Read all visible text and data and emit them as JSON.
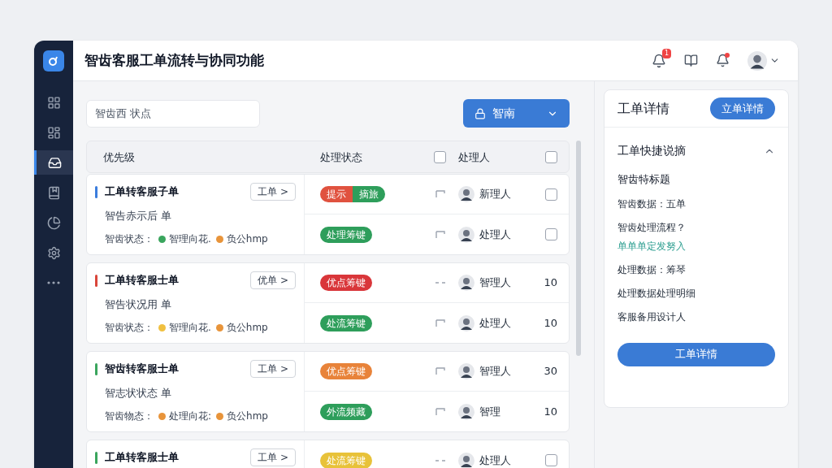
{
  "app": {
    "title": "智齿客服工单流转与协同功能"
  },
  "sidebar": {
    "items": [
      {
        "selected": false
      },
      {
        "selected": false
      },
      {
        "selected": true
      },
      {
        "selected": false
      },
      {
        "selected": false
      },
      {
        "selected": false
      },
      {
        "selected": false
      }
    ]
  },
  "header": {
    "notification_badge": "1",
    "profile_dot": true
  },
  "toolbar": {
    "search": {
      "placeholder": "智齿西 状点"
    },
    "dropdown": {
      "label": "智南"
    }
  },
  "table": {
    "columns": [
      {
        "label": "优先级",
        "kind": "text"
      },
      {
        "label": "处理状态",
        "kind": "text"
      },
      {
        "kind": "checkbox",
        "checked": false
      },
      {
        "label": "处理人",
        "kind": "text"
      },
      {
        "kind": "checkbox",
        "checked": false
      }
    ],
    "groups": [
      {
        "color": "#3b7ddd",
        "title": "工单转客服子单",
        "tag": "工单 >",
        "subtitle": "智告赤示后 单",
        "meta_label": "智齿状态：",
        "meta": [
          {
            "text": "智理向花.",
            "color": "#3aa55d"
          },
          {
            "text": "负公hmp",
            "color": "#e8943a"
          }
        ],
        "rows": [
          {
            "status": [
              {
                "text": "提示",
                "color": "#e0523f"
              },
              {
                "text": "摘旅",
                "color": "#2e9e5b"
              }
            ],
            "kind": "flag",
            "assignee": "新理人",
            "trailing": {
              "kind": "checkbox",
              "checked": false
            }
          },
          {
            "status": [
              {
                "text": "处理筹键",
                "color": "#2e9e5b"
              }
            ],
            "kind": "flag",
            "assignee": "处理人",
            "trailing": {
              "kind": "checkbox",
              "checked": false
            }
          }
        ]
      },
      {
        "color": "#d9453a",
        "title": "工单转客服士单",
        "tag": "优单 >",
        "subtitle": "智告状况用 单",
        "meta_label": "智齿状态：",
        "meta": [
          {
            "text": "智理向花.",
            "color": "#f0c040"
          },
          {
            "text": "负公hmp",
            "color": "#e8943a"
          }
        ],
        "rows": [
          {
            "status": [
              {
                "text": "优点筹键",
                "color": "#d9363a"
              }
            ],
            "kind": "dash",
            "assignee": "智理人",
            "trailing": {
              "kind": "count",
              "text": "10"
            }
          },
          {
            "status": [
              {
                "text": "处流筹键",
                "color": "#2e9e5b"
              }
            ],
            "kind": "flag",
            "assignee": "处理人",
            "trailing": {
              "kind": "count",
              "text": "10"
            }
          }
        ]
      },
      {
        "color": "#3aa55d",
        "title": "智齿转客服士单",
        "tag": "工单 >",
        "subtitle": "智志状状态 单",
        "meta_label": "智齿物态：",
        "meta": [
          {
            "text": "处理向花:",
            "color": "#e8943a"
          },
          {
            "text": "负公hmp",
            "color": "#e8943a"
          }
        ],
        "rows": [
          {
            "status": [
              {
                "text": "优点筹键",
                "color": "#e8833a"
              }
            ],
            "kind": "flag",
            "assignee": "智理人",
            "trailing": {
              "kind": "count",
              "text": "30"
            }
          },
          {
            "status": [
              {
                "text": "外流频藏",
                "color": "#2e9e5b"
              }
            ],
            "kind": "flag",
            "assignee": "智理",
            "trailing": {
              "kind": "count",
              "text": "10"
            }
          }
        ]
      },
      {
        "color": "#3aa55d",
        "title": "工单转客服士单",
        "tag": "工单 >",
        "rows": [
          {
            "status": [
              {
                "text": "处流筹键",
                "color": "#e8c23a"
              }
            ],
            "kind": "dash",
            "assignee": "处理人",
            "trailing": {
              "kind": "checkbox",
              "checked": false
            }
          }
        ]
      }
    ]
  },
  "detail": {
    "title": "工单详情",
    "action": "立单详情",
    "section": {
      "title": "工单快捷说摘",
      "expanded": true,
      "heading": "智齿特标题",
      "lines": [
        {
          "kind": "text",
          "text": "智齿数据：五单"
        },
        {
          "kind": "text",
          "text": "智齿处理流程？"
        },
        {
          "kind": "link",
          "text": "单单单定发努入"
        },
        {
          "kind": "text",
          "text": "处理数据：筹琴"
        },
        {
          "kind": "text",
          "text": "处理数据处理明细"
        },
        {
          "kind": "text",
          "text": "客服备用设计人"
        }
      ]
    },
    "button": "工单详情"
  }
}
